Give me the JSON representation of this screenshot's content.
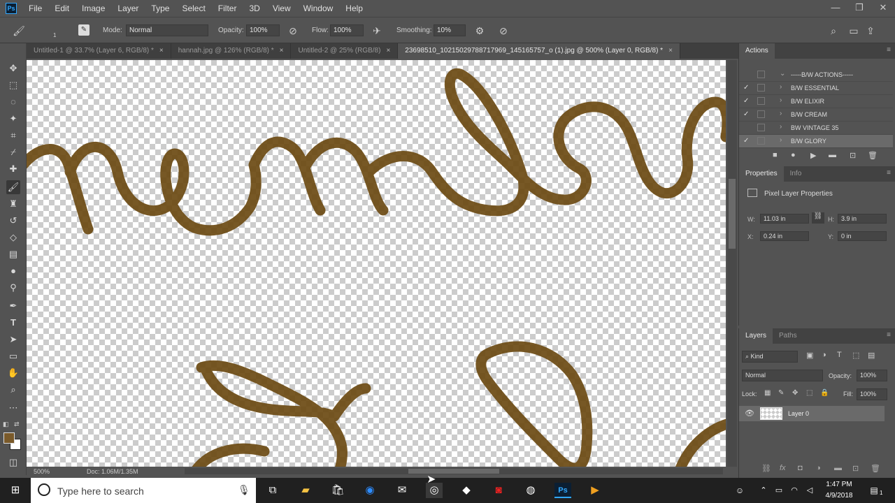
{
  "app": {
    "logo": "Ps"
  },
  "menu": [
    "File",
    "Edit",
    "Image",
    "Layer",
    "Type",
    "Select",
    "Filter",
    "3D",
    "View",
    "Window",
    "Help"
  ],
  "window_controls": {
    "minimize": "—",
    "restore": "❐",
    "close": "✕"
  },
  "options": {
    "brush_size": "1",
    "mode_label": "Mode:",
    "mode_value": "Normal",
    "opacity_label": "Opacity:",
    "opacity_value": "100%",
    "flow_label": "Flow:",
    "flow_value": "100%",
    "smoothing_label": "Smoothing:",
    "smoothing_value": "10%"
  },
  "tabs": [
    {
      "label": "Untitled-1 @ 33.7% (Layer 6, RGB/8) *",
      "close": "×"
    },
    {
      "label": "hannah.jpg @ 126% (RGB/8) *",
      "close": "×"
    },
    {
      "label": "Untitled-2 @ 25% (RGB/8)",
      "close": "×"
    },
    {
      "label": "23698510_10215029788717969_145165757_o (1).jpg @ 500% (Layer 0, RGB/8) *",
      "close": "×"
    }
  ],
  "status": {
    "zoom": "500%",
    "doc": "Doc: 1.06M/1.35M"
  },
  "actions_panel": {
    "title": "Actions",
    "items": [
      {
        "check": "",
        "arrow": "⌄",
        "label": "-----B/W ACTIONS-----"
      },
      {
        "check": "✓",
        "arrow": "›",
        "label": "B/W ESSENTIAL"
      },
      {
        "check": "✓",
        "arrow": "›",
        "label": "B/W ELIXIR"
      },
      {
        "check": "✓",
        "arrow": "›",
        "label": "B/W CREAM"
      },
      {
        "check": "",
        "arrow": "›",
        "label": "BW VINTAGE 35"
      },
      {
        "check": "✓",
        "arrow": "›",
        "label": "B/W GLORY"
      }
    ]
  },
  "properties_panel": {
    "tabs": [
      "Properties",
      "Info"
    ],
    "title": "Pixel Layer Properties",
    "w_label": "W:",
    "w_value": "11.03 in",
    "h_label": "H:",
    "h_value": "3.9 in",
    "x_label": "X:",
    "x_value": "0.24 in",
    "y_label": "Y:",
    "y_value": "0 in"
  },
  "layers_panel": {
    "tabs": [
      "Layers",
      "Paths"
    ],
    "filter_value": "Kind",
    "blend_value": "Normal",
    "opacity_label": "Opacity:",
    "opacity_value": "100%",
    "lock_label": "Lock:",
    "fill_label": "Fill:",
    "fill_value": "100%",
    "layers": [
      {
        "name": "Layer 0"
      }
    ]
  },
  "taskbar": {
    "search_placeholder": "Type here to search",
    "time": "1:47 PM",
    "date": "4/9/2018",
    "notification_count": "1"
  },
  "colors": {
    "ink": "#6b4a12",
    "foreground": "#7a5a2a",
    "background": "#ffffff",
    "ps_blue": "#31a8ff"
  }
}
